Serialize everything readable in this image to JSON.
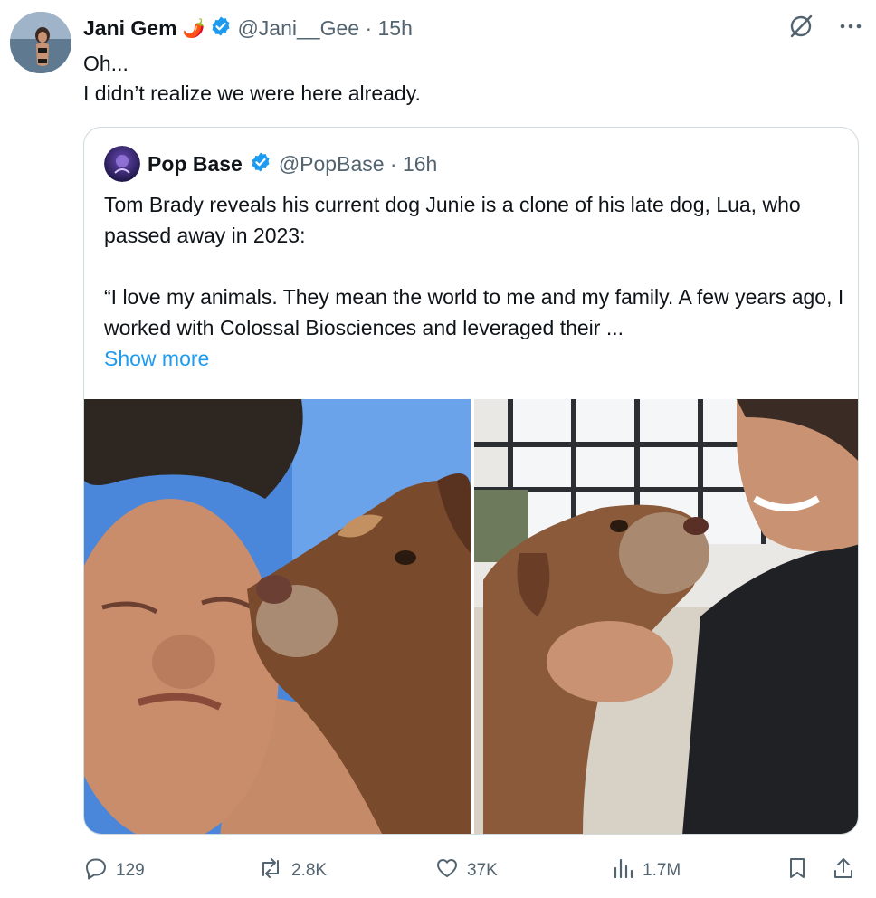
{
  "tweet": {
    "display_name": "Jani Gem",
    "name_emoji": "🌶️",
    "handle_time": "@Jani__Gee · 15h",
    "text_line1": "Oh...",
    "text_line2": "I didn’t realize we were here already."
  },
  "quote": {
    "display_name": "Pop Base",
    "handle_time": "@PopBase · 16h",
    "para1": "Tom Brady reveals his current dog Junie is a clone of his late dog, Lua, who passed away in 2023:",
    "para2": "“I love my animals. They mean the world to me and my family. A few years ago, I worked with Colossal Biosciences and leveraged their ...",
    "show_more": "Show more"
  },
  "actions": {
    "replies": "129",
    "reposts": "2.8K",
    "likes": "37K",
    "views": "1.7M"
  },
  "colors": {
    "verified_blue": "#1d9bf0",
    "secondary_text": "#536471",
    "border": "#cfd9de",
    "link": "#1d9bf0"
  },
  "icons": {
    "verified": "verified-badge-icon",
    "grok": "grok-icon",
    "more": "more-icon",
    "reply": "reply-icon",
    "repost": "repost-icon",
    "like": "like-icon",
    "views": "views-icon",
    "bookmark": "bookmark-icon",
    "share": "share-icon"
  }
}
